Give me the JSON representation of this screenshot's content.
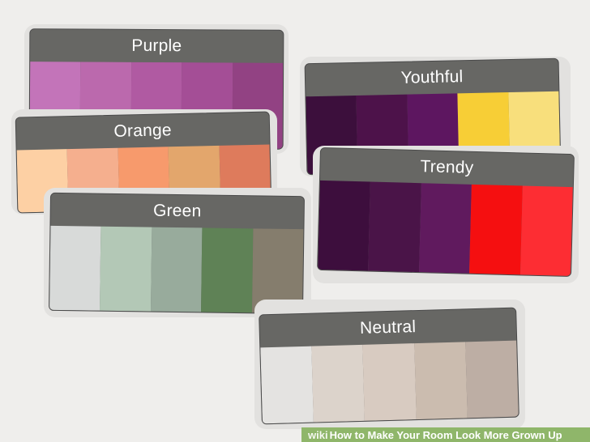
{
  "cards": [
    {
      "id": "purple",
      "title": "Purple",
      "colors": [
        "#c374b9",
        "#bb69ad",
        "#b05aa2",
        "#a44e96",
        "#924283"
      ]
    },
    {
      "id": "orange",
      "title": "Orange",
      "colors": [
        "#fdd0a4",
        "#f5af8e",
        "#f79a6c",
        "#e3a66c",
        "#de7b5c"
      ]
    },
    {
      "id": "green",
      "title": "Green",
      "colors": [
        "#d8dad9",
        "#b3c8b6",
        "#98ab9c",
        "#5f8256",
        "#857d6d"
      ]
    },
    {
      "id": "youthful",
      "title": "Youthful",
      "colors": [
        "#3c0f3c",
        "#4d124a",
        "#5d1660",
        "#f7ce36",
        "#f8df7c"
      ]
    },
    {
      "id": "trendy",
      "title": "Trendy",
      "colors": [
        "#3d0e3d",
        "#4a1448",
        "#601a5e",
        "#f50f10",
        "#fd2d33"
      ]
    },
    {
      "id": "neutral",
      "title": "Neutral",
      "colors": [
        "#e4e3e1",
        "#dcd3cb",
        "#d8cbc1",
        "#cbbcaf",
        "#bdaea4"
      ]
    }
  ],
  "watermark": {
    "brand": "wiki",
    "text": "How to Make Your Room Look More Grown Up"
  }
}
